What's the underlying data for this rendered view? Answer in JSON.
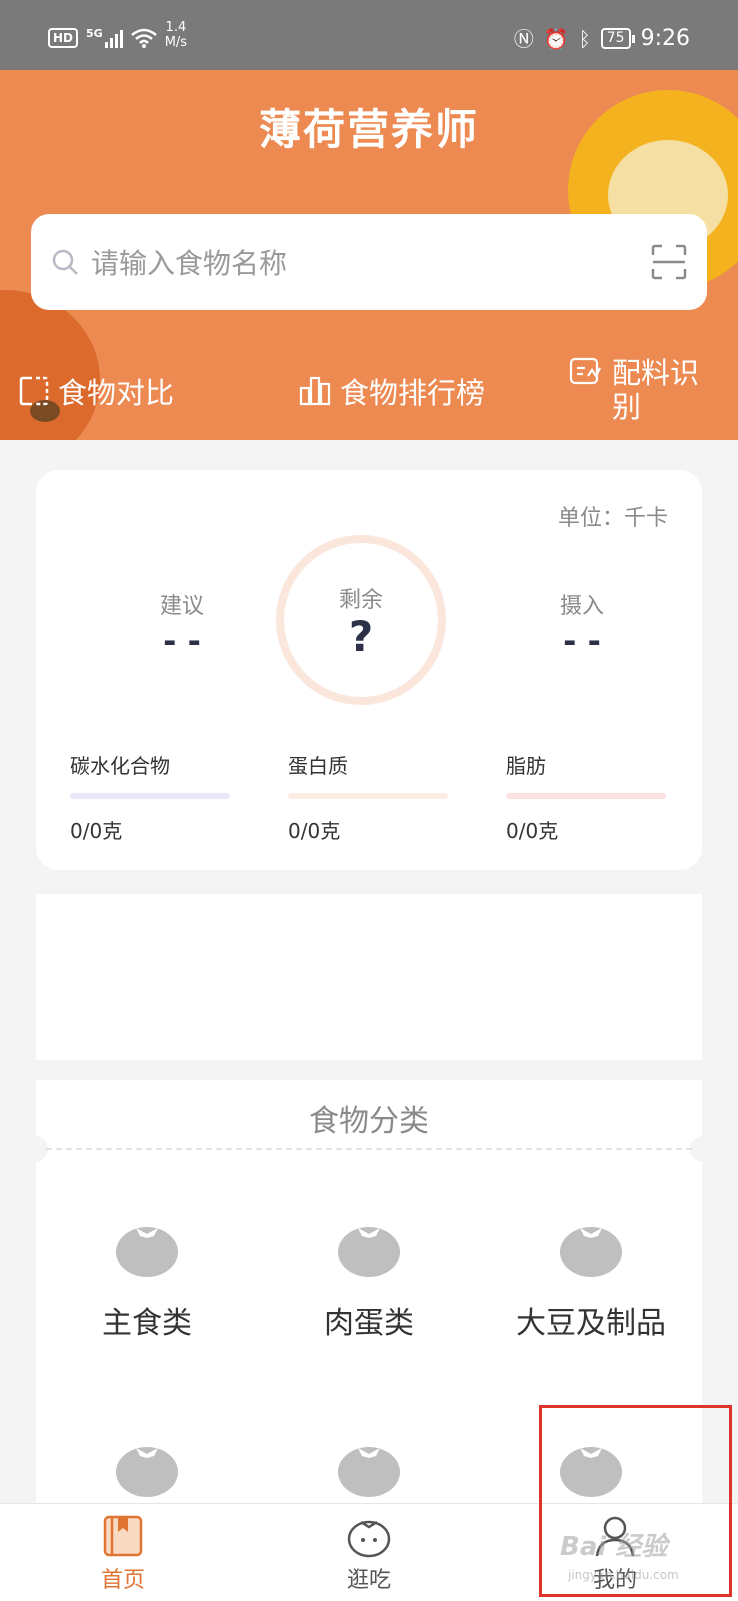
{
  "status_bar": {
    "hd": "HD",
    "signal_type": "5G",
    "speed_value": "1.4",
    "speed_unit": "M/s",
    "battery": "75",
    "time": "9:26"
  },
  "header": {
    "title": "薄荷营养师",
    "search_placeholder": "请输入食物名称",
    "quick_links": [
      {
        "label": "食物对比",
        "icon": "compare-icon"
      },
      {
        "label": "食物排行榜",
        "icon": "ranking-icon"
      },
      {
        "label": "配料识别",
        "icon": "ingredient-scan-icon"
      }
    ]
  },
  "calorie_card": {
    "unit": "单位：千卡",
    "suggested": {
      "label": "建议",
      "value": "- -"
    },
    "remaining": {
      "label": "剩余",
      "value": "?"
    },
    "intake": {
      "label": "摄入",
      "value": "- -"
    },
    "macros": [
      {
        "label": "碳水化合物",
        "value": "0/0克",
        "color": "#e9e8f8"
      },
      {
        "label": "蛋白质",
        "value": "0/0克",
        "color": "#fbece4"
      },
      {
        "label": "脂肪",
        "value": "0/0克",
        "color": "#fbe1e1"
      }
    ]
  },
  "categories": {
    "title": "食物分类",
    "items": [
      {
        "label": "主食类"
      },
      {
        "label": "肉蛋类"
      },
      {
        "label": "大豆及制品"
      }
    ]
  },
  "tabbar": {
    "items": [
      {
        "label": "首页",
        "icon": "home-book-icon",
        "active": true
      },
      {
        "label": "逛吃",
        "icon": "explore-fruit-icon",
        "active": false
      },
      {
        "label": "我的",
        "icon": "profile-person-icon",
        "active": false
      }
    ]
  },
  "watermark": {
    "brand": "Bai 经验",
    "url": "jingyan.baidu.com"
  },
  "colors": {
    "header_bg": "#ec8a52",
    "accent": "#e07432",
    "highlight": "#e0332b"
  }
}
